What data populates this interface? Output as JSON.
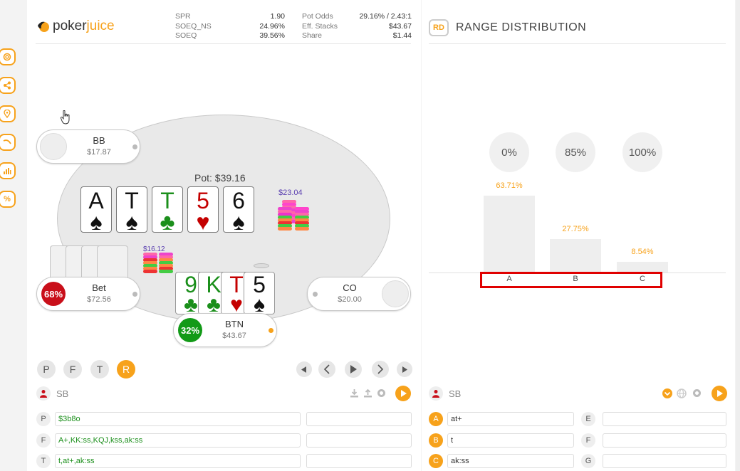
{
  "brand": {
    "poker": "poker",
    "juice": "juice"
  },
  "stats_left": [
    {
      "label": "SPR",
      "value": "1.90"
    },
    {
      "label": "SOEQ_NS",
      "value": "24.96%"
    },
    {
      "label": "SOEQ",
      "value": "39.56%"
    }
  ],
  "stats_right": [
    {
      "label": "Pot Odds",
      "value": "29.16% / 2.43:1"
    },
    {
      "label": "Eff. Stacks",
      "value": "$43.67"
    },
    {
      "label": "Share",
      "value": "$1.44"
    }
  ],
  "sidebar": {
    "icons": [
      "lifebuoy-icon",
      "share-icon",
      "location-icon",
      "curve-icon",
      "bar-chart-icon",
      "percent-icon"
    ],
    "percent_label": "%"
  },
  "table": {
    "pot": "Pot: $39.16",
    "board": [
      {
        "rank": "A",
        "suit": "♠",
        "color": "black"
      },
      {
        "rank": "T",
        "suit": "♠",
        "color": "black"
      },
      {
        "rank": "T",
        "suit": "♣",
        "color": "green"
      },
      {
        "rank": "5",
        "suit": "♥",
        "color": "red"
      },
      {
        "rank": "6",
        "suit": "♠",
        "color": "black"
      }
    ],
    "pot_chips_label": "$23.04",
    "bet_chips_label": "$16.12",
    "seats": {
      "bb": {
        "name": "BB",
        "stack": "$17.87"
      },
      "sb": {
        "name": "Bet",
        "stack": "$72.56",
        "pct": "68%"
      },
      "co": {
        "name": "CO",
        "stack": "$20.00"
      },
      "btn": {
        "name": "BTN",
        "stack": "$43.67",
        "pct": "32%"
      }
    },
    "hero_cards": [
      {
        "rank": "9",
        "suit": "♣",
        "color": "green"
      },
      {
        "rank": "K",
        "suit": "♣",
        "color": "green"
      },
      {
        "rank": "T",
        "suit": "♥",
        "color": "red"
      },
      {
        "rank": "5",
        "suit": "♠",
        "color": "black"
      }
    ]
  },
  "controls": {
    "streets": [
      "P",
      "F",
      "T",
      "R"
    ],
    "active_street": "R"
  },
  "left_player": {
    "name": "SB"
  },
  "left_ranges": [
    {
      "key": "P",
      "value": "$3b8o",
      "extra": ""
    },
    {
      "key": "F",
      "value": "A+,KK:ss,KQJ,kss,ak:ss",
      "extra": ""
    },
    {
      "key": "T",
      "value": "t,at+,ak:ss",
      "extra": ""
    }
  ],
  "right_panel": {
    "badge": "RD",
    "title": "RANGE DISTRIBUTION",
    "player": "SB"
  },
  "chart_data": {
    "type": "bar",
    "categories": [
      "A",
      "B",
      "C"
    ],
    "values": [
      63.71,
      27.75,
      8.54
    ],
    "value_labels": [
      "63.71%",
      "27.75%",
      "8.54%"
    ],
    "equity_headers": [
      "0%",
      "85%",
      "100%"
    ],
    "title": "",
    "xlabel": "",
    "ylabel": "",
    "ylim": [
      0,
      100
    ],
    "highlight_color": "#e00000"
  },
  "right_ranges": [
    {
      "key": "A",
      "value": "at+",
      "key2": "E",
      "value2": ""
    },
    {
      "key": "B",
      "value": "t",
      "key2": "F",
      "value2": ""
    },
    {
      "key": "C",
      "value": "ak:ss",
      "key2": "G",
      "value2": ""
    }
  ]
}
